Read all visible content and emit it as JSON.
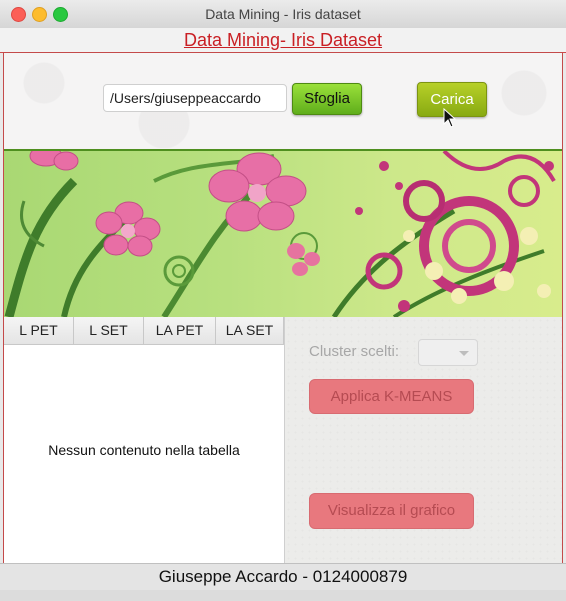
{
  "window": {
    "title": "Data Mining - Iris dataset"
  },
  "header": {
    "title": "Data Mining- Iris Dataset"
  },
  "file": {
    "path": "/Users/giuseppeaccardo",
    "browse_label": "Sfoglia",
    "load_label": "Carica"
  },
  "table": {
    "columns": [
      "L PET",
      "L SET",
      "LA PET",
      "LA SET"
    ],
    "empty_message": "Nessun contenuto nella tabella"
  },
  "controls": {
    "cluster_label": "Cluster scelti:",
    "kmeans_label": "Applica K-MEANS",
    "chart_label": "Visualizza il grafico"
  },
  "footer": {
    "text": "Giuseppe Accardo - 0124000879"
  },
  "colors": {
    "accent_red": "#c91f24",
    "button_green": "#5fae1b",
    "button_red": "#e8787e"
  }
}
